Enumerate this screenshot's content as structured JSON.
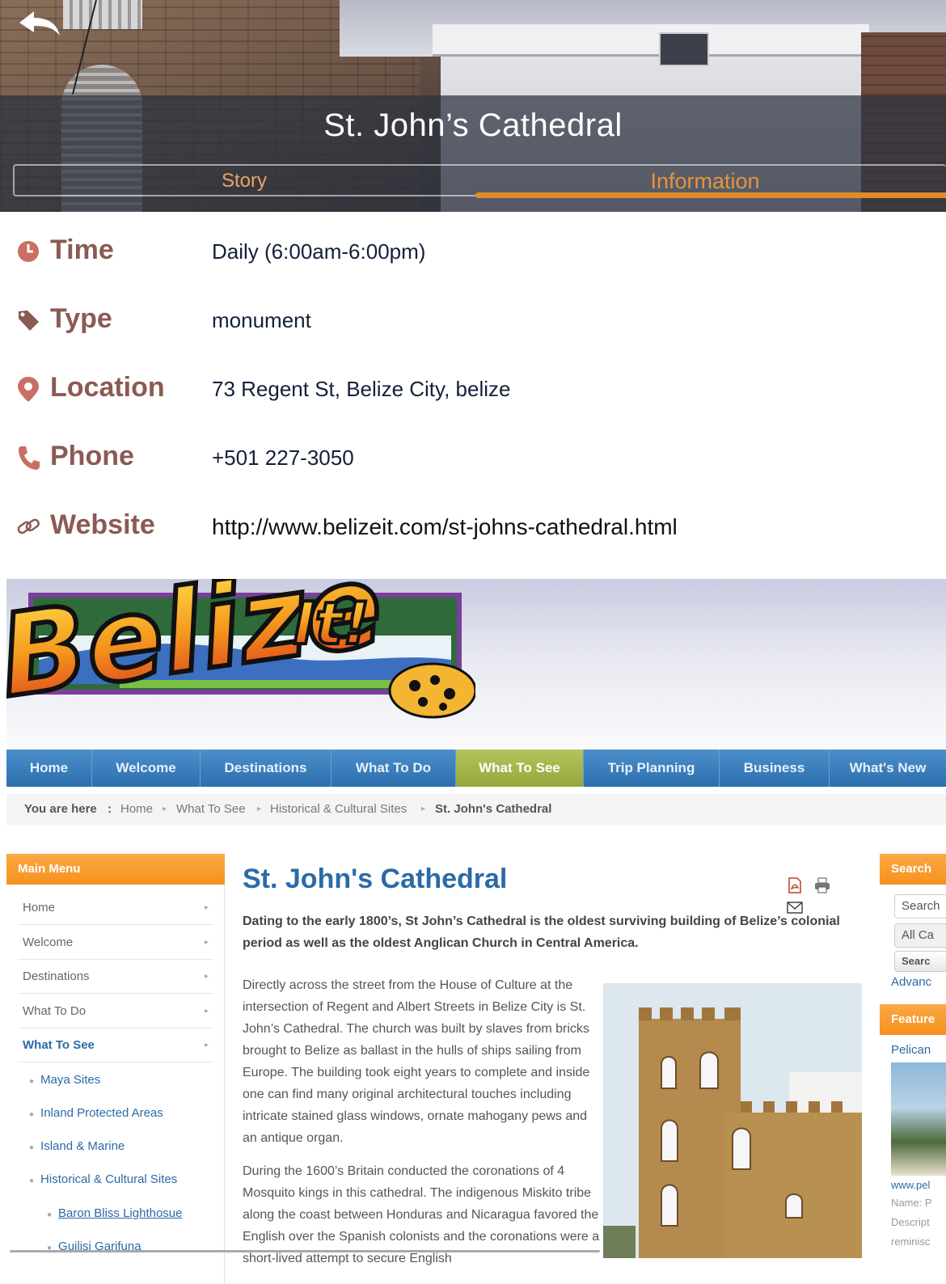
{
  "header": {
    "title": "St. John’s Cathedral",
    "tabs": [
      {
        "label": "Story",
        "active": false
      },
      {
        "label": "Information",
        "active": true
      }
    ],
    "accent_color": "#e08a2c"
  },
  "info": [
    {
      "label": "Time",
      "value": "Daily (6:00am-6:00pm)",
      "icon": "clock-icon"
    },
    {
      "label": "Type",
      "value": "monument",
      "icon": "tag-icon"
    },
    {
      "label": "Location",
      "value": "73 Regent St, Belize City, belize",
      "icon": "map-pin-icon"
    },
    {
      "label": "Phone",
      "value": "+501 227-3050",
      "icon": "phone-icon"
    },
    {
      "label": "Website",
      "value": "http://www.belizeit.com/st-johns-cathedral.html",
      "icon": "link-icon"
    }
  ],
  "website": {
    "logo_text": "Belize It!",
    "nav": [
      "Home",
      "Welcome",
      "Destinations",
      "What To Do",
      "What To See",
      "Trip Planning",
      "Business",
      "What's New"
    ],
    "nav_active": "What To See",
    "breadcrumb": {
      "prefix": "You are here",
      "colon": ":",
      "items": [
        "Home",
        "What To See",
        "Historical & Cultural Sites",
        "St. John's Cathedral"
      ]
    },
    "main_menu": {
      "title": "Main Menu",
      "items": [
        "Home",
        "Welcome",
        "Destinations",
        "What To Do",
        "What To See"
      ],
      "sub_items": [
        "Maya Sites",
        "Inland Protected Areas",
        "Island & Marine",
        "Historical & Cultural Sites"
      ],
      "sub_sub_items": [
        "Baron Bliss Lighthosue",
        "Guilisi Garifuna"
      ]
    },
    "article": {
      "title": "St. John's Cathedral",
      "lead": "Dating to the early 1800’s, St John’s Cathedral is the oldest surviving building of Belize’s colonial period as well as the oldest Anglican Church in Central America.",
      "para1": "Directly across the street from the House of Culture at the intersection of Regent and Albert Streets in Belize City is St. John’s Cathedral. The church was built by slaves from bricks brought to Belize as ballast in the hulls of ships sailing from Europe.  The building took eight years to complete and inside one can find many original architectural touches including intricate stained glass windows, ornate mahogany pews and an antique organ.",
      "para2": "During the 1600’s Britain conducted the coronations of 4 Mosquito kings in this cathedral. The indigenous Miskito tribe along the coast between Honduras and Nicaragua favored the English over the Spanish colonists and the coronations were a short-lived attempt to secure English"
    },
    "right": {
      "search_title": "Search",
      "search_placeholder": "Search",
      "category": "All Ca",
      "search_button": "Searc",
      "advanced": "Advanc",
      "featured_title": "Feature",
      "featured_link": "Pelican",
      "featured_url": "www.pel",
      "name_label": "Name: P",
      "desc_label": "Descript",
      "desc_text": "reminisc"
    }
  }
}
